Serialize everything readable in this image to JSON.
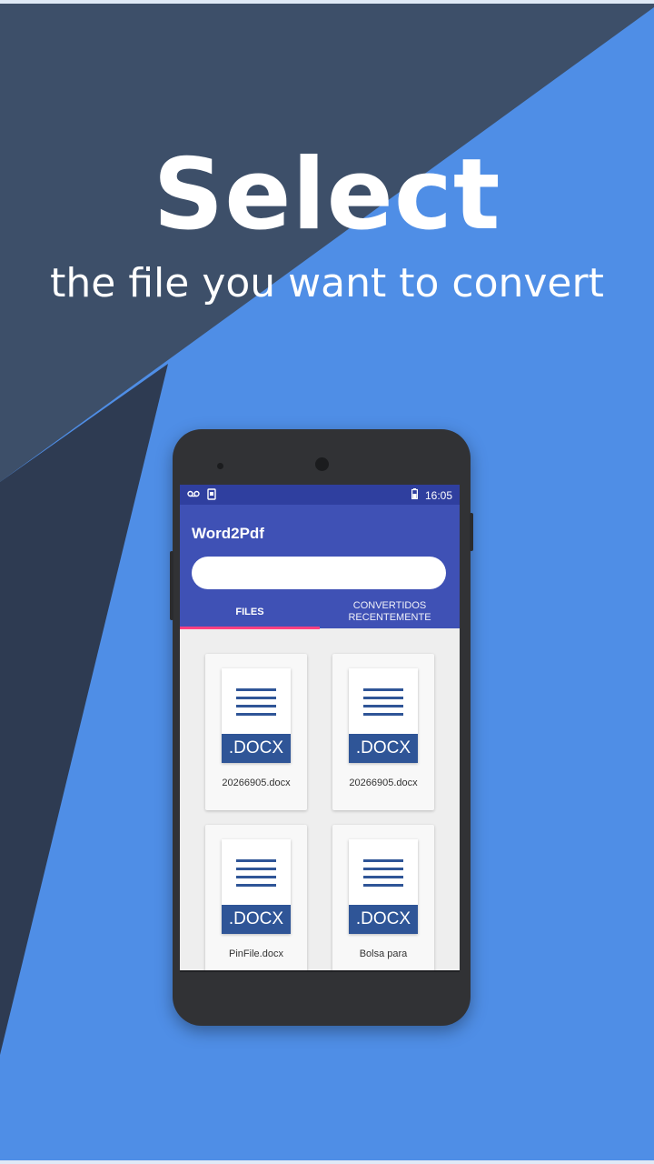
{
  "promo": {
    "title": "Select",
    "subtitle": "the file you want to convert"
  },
  "colors": {
    "background_blue": "#4f8ee6",
    "dark_slate": "#3d4f69",
    "navy": "#2e3b52",
    "app_primary": "#3f51b5",
    "status_bar": "#2f3f9f",
    "tab_indicator": "#ff4081",
    "docx_blue": "#2f5597"
  },
  "status_bar": {
    "left_icons": [
      "voicemail-icon",
      "screenshot-icon"
    ],
    "battery_icon": "battery-icon",
    "time": "16:05"
  },
  "app": {
    "title": "Word2Pdf",
    "search": {
      "value": "",
      "placeholder": ""
    },
    "tabs": [
      {
        "label": "FILES",
        "selected": true
      },
      {
        "label": "CONVERTIDOS\nRECENTEMENTE",
        "selected": false
      }
    ],
    "files": [
      {
        "name": "20266905.docx",
        "badge": ".DOCX",
        "icon": "docx-file-icon"
      },
      {
        "name": "20266905.docx",
        "badge": ".DOCX",
        "icon": "docx-file-icon"
      },
      {
        "name": "PinFile.docx",
        "badge": ".DOCX",
        "icon": "docx-file-icon"
      },
      {
        "name": "Bolsa para",
        "badge": ".DOCX",
        "icon": "docx-file-icon"
      }
    ]
  }
}
